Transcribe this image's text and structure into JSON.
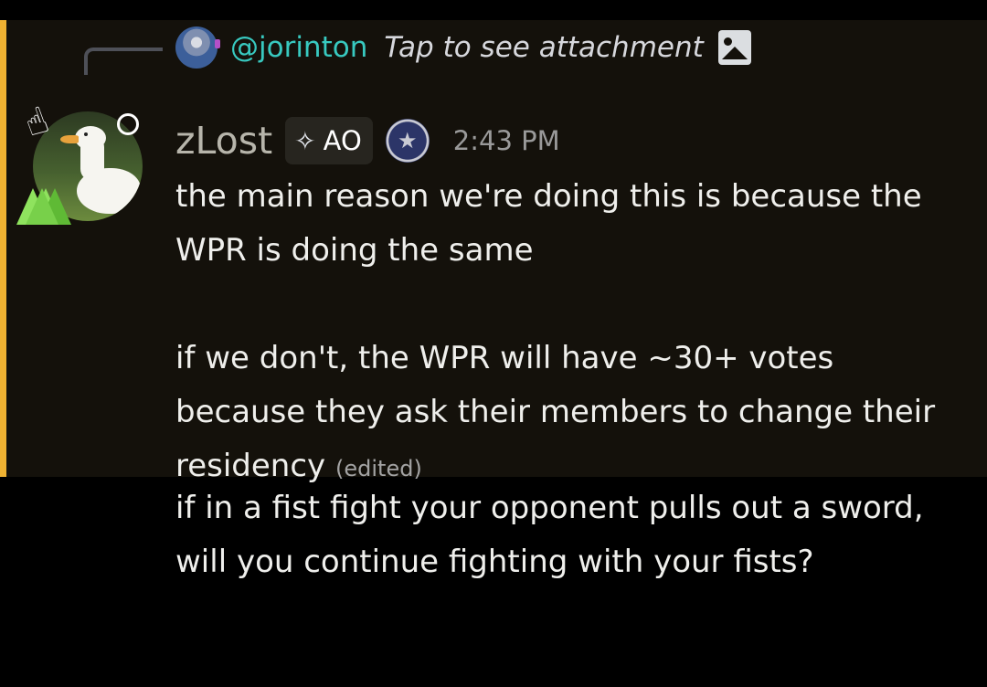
{
  "reply": {
    "username": "@jorinton",
    "preview": "Tap to see attachment",
    "attachment_icon": "image-icon"
  },
  "message": {
    "author": "zLost",
    "tag": {
      "icon": "diamond-sparkle-icon",
      "label": "AO"
    },
    "badge_icon": "star-badge-icon",
    "timestamp": "2:43 PM",
    "paragraph1": "the main reason we're doing this is because the WPR is doing the same",
    "paragraph2": "if we don't, the WPR will have ~30+ votes because they ask their members to change their residency",
    "edited_label": "(edited)",
    "highlight_color": "#f0b232"
  },
  "next_message": {
    "text": "if in a fist fight your opponent pulls out a sword, will you continue fighting with your fists?"
  }
}
